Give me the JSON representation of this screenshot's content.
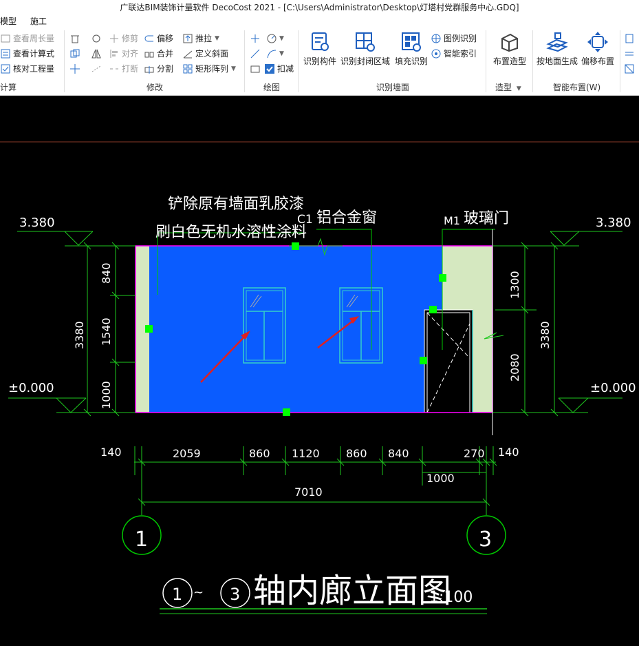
{
  "window": {
    "title": "广联达BIM装饰计量软件 DecoCost 2021 - [C:\\Users\\Administrator\\Desktop\\灯塔村党群服务中心.GDQ]"
  },
  "menu": {
    "items": [
      "模型",
      "施工"
    ]
  },
  "ribbon": {
    "groups": {
      "calc": {
        "label": "计算",
        "items": [
          "查看周长量",
          "查看计算式",
          "核对工程量"
        ]
      },
      "modify": {
        "label": "修改",
        "col2": [
          "修剪",
          "对齐",
          "打断"
        ],
        "col3": [
          "偏移",
          "合并",
          "分割"
        ],
        "col4": [
          "推拉",
          "定义斜面",
          "矩形阵列"
        ]
      },
      "draw": {
        "label": "绘图",
        "deduct_label": "扣减"
      },
      "recognize_wall": {
        "label": "识别墙面",
        "big": [
          "识别构件",
          "识别封闭区域",
          "填充识别"
        ],
        "small": [
          "图例识别",
          "智能索引"
        ]
      },
      "model": {
        "label": "造型",
        "big": "布置造型"
      },
      "smart": {
        "label": "智能布置(W)",
        "big": [
          "按地面生成",
          "偏移布置"
        ]
      }
    }
  },
  "drawing": {
    "colors": {
      "wall_fill": "#0a5cff",
      "side_fill": "#d5e8c0",
      "dimension": "#1ec81e",
      "grip": "#00ff00",
      "axis": "#00c800",
      "text": "#ffffff",
      "arrow": "#e02020",
      "outline": "#ff00ff",
      "window": "#35d0c8",
      "top_line": "#8a3a28"
    },
    "annotations": {
      "note_line1": "铲除原有墙面乳胶漆",
      "note_line2": "刷白色无机水溶性涂料",
      "window_code": "C1",
      "window_name": "铝合金窗",
      "door_code": "M1",
      "door_name": "玻璃门"
    },
    "elevations": {
      "left_top": "3.380",
      "left_bottom": "±0.000",
      "right_top": "3.380",
      "right_bottom": "±0.000"
    },
    "left_dims": {
      "total": "3380",
      "upper": "840",
      "middle": "1540",
      "lower": "1000"
    },
    "right_dims": {
      "total": "3380",
      "upper": "1300",
      "lower": "2080"
    },
    "bottom_dims": {
      "row1": [
        "140",
        "2059",
        "860",
        "1120",
        "860",
        "840",
        "270",
        "140"
      ],
      "row2": "1000",
      "total": "7010"
    },
    "axes": {
      "left": "1",
      "right": "3"
    },
    "title": {
      "axis_from": "1",
      "tilde": "~",
      "axis_to": "3",
      "text": "轴内廊立面图",
      "scale": "1:100"
    }
  }
}
